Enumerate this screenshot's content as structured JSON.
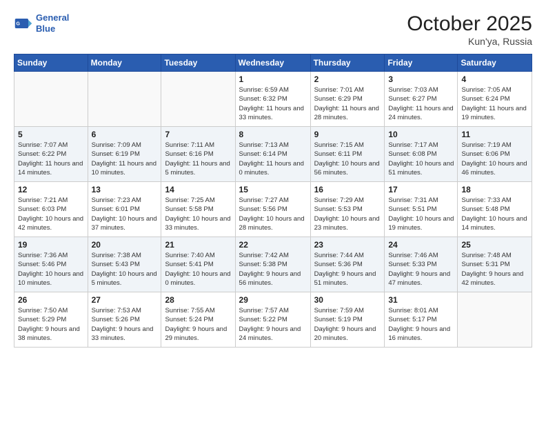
{
  "header": {
    "logo_line1": "General",
    "logo_line2": "Blue",
    "month_title": "October 2025",
    "location": "Kun'ya, Russia"
  },
  "days_of_week": [
    "Sunday",
    "Monday",
    "Tuesday",
    "Wednesday",
    "Thursday",
    "Friday",
    "Saturday"
  ],
  "weeks": [
    [
      {
        "num": "",
        "info": ""
      },
      {
        "num": "",
        "info": ""
      },
      {
        "num": "",
        "info": ""
      },
      {
        "num": "1",
        "info": "Sunrise: 6:59 AM\nSunset: 6:32 PM\nDaylight: 11 hours\nand 33 minutes."
      },
      {
        "num": "2",
        "info": "Sunrise: 7:01 AM\nSunset: 6:29 PM\nDaylight: 11 hours\nand 28 minutes."
      },
      {
        "num": "3",
        "info": "Sunrise: 7:03 AM\nSunset: 6:27 PM\nDaylight: 11 hours\nand 24 minutes."
      },
      {
        "num": "4",
        "info": "Sunrise: 7:05 AM\nSunset: 6:24 PM\nDaylight: 11 hours\nand 19 minutes."
      }
    ],
    [
      {
        "num": "5",
        "info": "Sunrise: 7:07 AM\nSunset: 6:22 PM\nDaylight: 11 hours\nand 14 minutes."
      },
      {
        "num": "6",
        "info": "Sunrise: 7:09 AM\nSunset: 6:19 PM\nDaylight: 11 hours\nand 10 minutes."
      },
      {
        "num": "7",
        "info": "Sunrise: 7:11 AM\nSunset: 6:16 PM\nDaylight: 11 hours\nand 5 minutes."
      },
      {
        "num": "8",
        "info": "Sunrise: 7:13 AM\nSunset: 6:14 PM\nDaylight: 11 hours\nand 0 minutes."
      },
      {
        "num": "9",
        "info": "Sunrise: 7:15 AM\nSunset: 6:11 PM\nDaylight: 10 hours\nand 56 minutes."
      },
      {
        "num": "10",
        "info": "Sunrise: 7:17 AM\nSunset: 6:08 PM\nDaylight: 10 hours\nand 51 minutes."
      },
      {
        "num": "11",
        "info": "Sunrise: 7:19 AM\nSunset: 6:06 PM\nDaylight: 10 hours\nand 46 minutes."
      }
    ],
    [
      {
        "num": "12",
        "info": "Sunrise: 7:21 AM\nSunset: 6:03 PM\nDaylight: 10 hours\nand 42 minutes."
      },
      {
        "num": "13",
        "info": "Sunrise: 7:23 AM\nSunset: 6:01 PM\nDaylight: 10 hours\nand 37 minutes."
      },
      {
        "num": "14",
        "info": "Sunrise: 7:25 AM\nSunset: 5:58 PM\nDaylight: 10 hours\nand 33 minutes."
      },
      {
        "num": "15",
        "info": "Sunrise: 7:27 AM\nSunset: 5:56 PM\nDaylight: 10 hours\nand 28 minutes."
      },
      {
        "num": "16",
        "info": "Sunrise: 7:29 AM\nSunset: 5:53 PM\nDaylight: 10 hours\nand 23 minutes."
      },
      {
        "num": "17",
        "info": "Sunrise: 7:31 AM\nSunset: 5:51 PM\nDaylight: 10 hours\nand 19 minutes."
      },
      {
        "num": "18",
        "info": "Sunrise: 7:33 AM\nSunset: 5:48 PM\nDaylight: 10 hours\nand 14 minutes."
      }
    ],
    [
      {
        "num": "19",
        "info": "Sunrise: 7:36 AM\nSunset: 5:46 PM\nDaylight: 10 hours\nand 10 minutes."
      },
      {
        "num": "20",
        "info": "Sunrise: 7:38 AM\nSunset: 5:43 PM\nDaylight: 10 hours\nand 5 minutes."
      },
      {
        "num": "21",
        "info": "Sunrise: 7:40 AM\nSunset: 5:41 PM\nDaylight: 10 hours\nand 0 minutes."
      },
      {
        "num": "22",
        "info": "Sunrise: 7:42 AM\nSunset: 5:38 PM\nDaylight: 9 hours\nand 56 minutes."
      },
      {
        "num": "23",
        "info": "Sunrise: 7:44 AM\nSunset: 5:36 PM\nDaylight: 9 hours\nand 51 minutes."
      },
      {
        "num": "24",
        "info": "Sunrise: 7:46 AM\nSunset: 5:33 PM\nDaylight: 9 hours\nand 47 minutes."
      },
      {
        "num": "25",
        "info": "Sunrise: 7:48 AM\nSunset: 5:31 PM\nDaylight: 9 hours\nand 42 minutes."
      }
    ],
    [
      {
        "num": "26",
        "info": "Sunrise: 7:50 AM\nSunset: 5:29 PM\nDaylight: 9 hours\nand 38 minutes."
      },
      {
        "num": "27",
        "info": "Sunrise: 7:53 AM\nSunset: 5:26 PM\nDaylight: 9 hours\nand 33 minutes."
      },
      {
        "num": "28",
        "info": "Sunrise: 7:55 AM\nSunset: 5:24 PM\nDaylight: 9 hours\nand 29 minutes."
      },
      {
        "num": "29",
        "info": "Sunrise: 7:57 AM\nSunset: 5:22 PM\nDaylight: 9 hours\nand 24 minutes."
      },
      {
        "num": "30",
        "info": "Sunrise: 7:59 AM\nSunset: 5:19 PM\nDaylight: 9 hours\nand 20 minutes."
      },
      {
        "num": "31",
        "info": "Sunrise: 8:01 AM\nSunset: 5:17 PM\nDaylight: 9 hours\nand 16 minutes."
      },
      {
        "num": "",
        "info": ""
      }
    ]
  ]
}
